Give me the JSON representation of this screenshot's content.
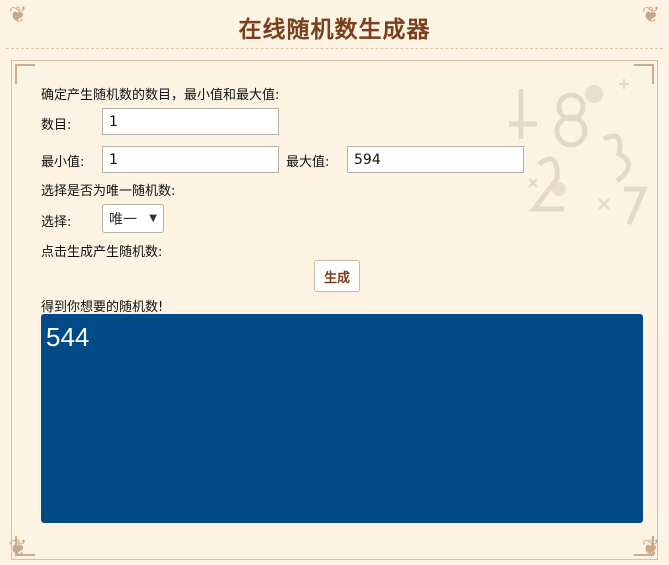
{
  "page": {
    "title": "在线随机数生成器"
  },
  "form": {
    "intro": "确定产生随机数的数目，最小值和最大值:",
    "count_label": "数目:",
    "count_value": "1",
    "min_label": "最小值:",
    "min_value": "1",
    "max_label": "最大值:",
    "max_value": "594",
    "unique_prompt": "选择是否为唯一随机数:",
    "select_label": "选择:",
    "select_value": "唯一",
    "generate_prompt": "点击生成产生随机数:",
    "generate_button": "生成",
    "result_label": "得到你想要的随机数!",
    "result_value": "544"
  },
  "colors": {
    "background": "#fcf3e3",
    "title": "#7a3f1d",
    "result_bg": "#004a88",
    "result_text": "#ffffff"
  },
  "icons": {
    "select_chevron": "chevron-down-icon",
    "decoration": "number-decoration-icon"
  }
}
